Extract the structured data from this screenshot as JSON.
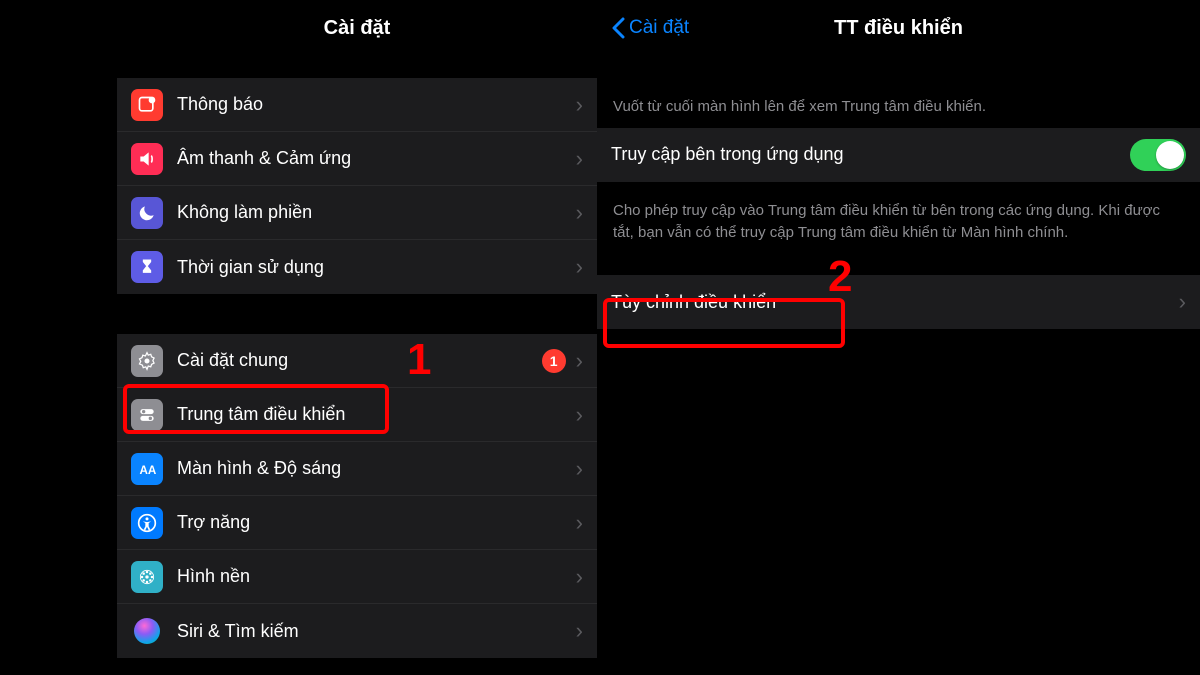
{
  "left": {
    "title": "Cài đặt",
    "group1": [
      {
        "icon": "notification-icon",
        "label": "Thông báo"
      },
      {
        "icon": "sound-icon",
        "label": "Âm thanh & Cảm ứng"
      },
      {
        "icon": "moon-icon",
        "label": "Không làm phiền"
      },
      {
        "icon": "hourglass-icon",
        "label": "Thời gian sử dụng"
      }
    ],
    "group2": [
      {
        "icon": "gear-icon",
        "label": "Cài đặt chung",
        "badge": "1"
      },
      {
        "icon": "switches-icon",
        "label": "Trung tâm điều khiển",
        "highlight": true
      },
      {
        "icon": "textsize-icon",
        "label": "Màn hình & Độ sáng"
      },
      {
        "icon": "accessibility-icon",
        "label": "Trợ năng"
      },
      {
        "icon": "wallpaper-icon",
        "label": "Hình nền"
      },
      {
        "icon": "siri-icon",
        "label": "Siri & Tìm kiếm"
      }
    ],
    "step_number": "1"
  },
  "right": {
    "back_label": "Cài đặt",
    "title": "TT điều khiển",
    "hint": "Vuốt từ cuối màn hình lên để xem Trung tâm điều khiển.",
    "toggle_label": "Truy cập bên trong ứng dụng",
    "toggle_on": true,
    "toggle_caption": "Cho phép truy cập vào Trung tâm điều khiển từ bên trong các ứng dụng. Khi được tắt, bạn vẫn có thể truy cập Trung tâm điều khiển từ Màn hình chính.",
    "customize_label": "Tùy chỉnh điều khiển",
    "step_number": "2"
  }
}
